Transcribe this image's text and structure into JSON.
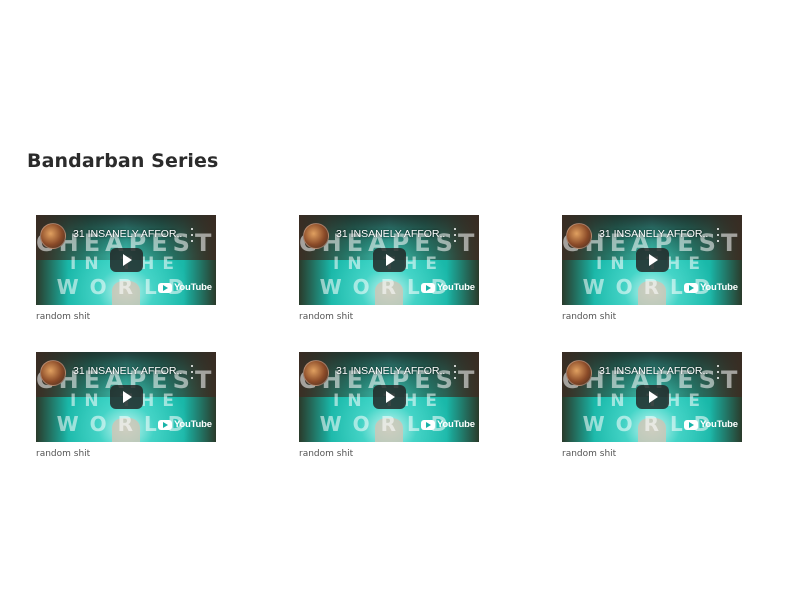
{
  "page": {
    "title": "Bandarban Series"
  },
  "videos": [
    {
      "title": "31 INSANELY AFFOR...",
      "big_text_1": "CHEAPEST",
      "big_text_2": "IN THE",
      "big_text_3": "WORLD",
      "logo": "YouTube",
      "caption": "random shit"
    },
    {
      "title": "31 INSANELY AFFOR...",
      "big_text_1": "CHEAPEST",
      "big_text_2": "IN THE",
      "big_text_3": "WORLD",
      "logo": "YouTube",
      "caption": "random shit"
    },
    {
      "title": "31 INSANELY AFFOR...",
      "big_text_1": "CHEAPEST",
      "big_text_2": "IN THE",
      "big_text_3": "WORLD",
      "logo": "YouTube",
      "caption": "random shit"
    },
    {
      "title": "31 INSANELY AFFOR...",
      "big_text_1": "CHEAPEST",
      "big_text_2": "IN THE",
      "big_text_3": "WORLD",
      "logo": "YouTube",
      "caption": "random shit"
    },
    {
      "title": "31 INSANELY AFFOR...",
      "big_text_1": "CHEAPEST",
      "big_text_2": "IN THE",
      "big_text_3": "WORLD",
      "logo": "YouTube",
      "caption": "random shit"
    },
    {
      "title": "31 INSANELY AFFOR...",
      "big_text_1": "CHEAPEST",
      "big_text_2": "IN THE",
      "big_text_3": "WORLD",
      "logo": "YouTube",
      "caption": "random shit"
    }
  ],
  "colors": {
    "water": "#26d2c2",
    "title_text": "#2b2b2b",
    "caption_text": "#555555"
  }
}
